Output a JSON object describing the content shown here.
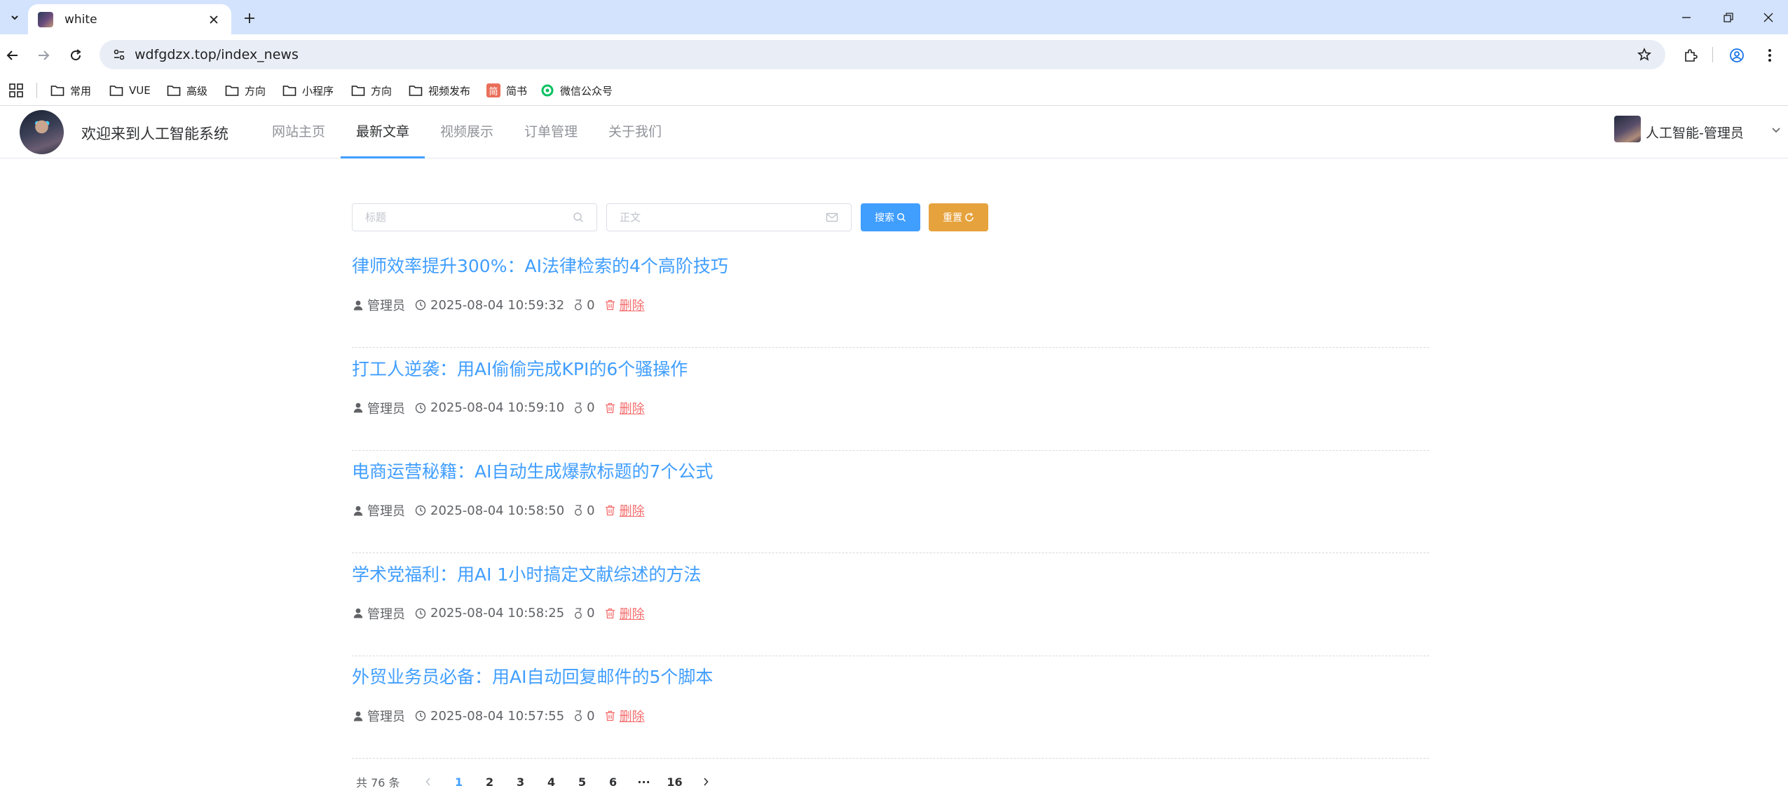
{
  "browser": {
    "tab_title": "white",
    "url": "wdfgdzx.top/index_news",
    "bookmarks": [
      "常用",
      "VUE",
      "高级",
      "方向",
      "小程序",
      "方向",
      "视频发布",
      "简书",
      "微信公众号"
    ],
    "jianshu_glyph": "简"
  },
  "header": {
    "site_title": "欢迎来到人工智能系统",
    "nav": [
      "网站主页",
      "最新文章",
      "视频展示",
      "订单管理",
      "关于我们"
    ],
    "active_nav": 1,
    "user_name": "人工智能-管理员"
  },
  "search": {
    "title_placeholder": "标题",
    "content_placeholder": "正文",
    "search_label": "搜索",
    "reset_label": "重置"
  },
  "articles": [
    {
      "title": "律师效率提升300%：AI法律检索的4个高阶技巧",
      "author": "管理员",
      "time": "2025-08-04 10:59:32",
      "count": "0",
      "delete_label": "删除"
    },
    {
      "title": "打工人逆袭：用AI偷偷完成KPI的6个骚操作",
      "author": "管理员",
      "time": "2025-08-04 10:59:10",
      "count": "0",
      "delete_label": "删除"
    },
    {
      "title": "电商运营秘籍：AI自动生成爆款标题的7个公式",
      "author": "管理员",
      "time": "2025-08-04 10:58:50",
      "count": "0",
      "delete_label": "删除"
    },
    {
      "title": "学术党福利：用AI 1小时搞定文献综述的方法",
      "author": "管理员",
      "time": "2025-08-04 10:58:25",
      "count": "0",
      "delete_label": "删除"
    },
    {
      "title": "外贸业务员必备：用AI自动回复邮件的5个脚本",
      "author": "管理员",
      "time": "2025-08-04 10:57:55",
      "count": "0",
      "delete_label": "删除"
    }
  ],
  "pagination": {
    "total_label": "共 76 条",
    "pages": [
      "1",
      "2",
      "3",
      "4",
      "5",
      "6",
      "···",
      "16"
    ],
    "current": "1"
  },
  "colors": {
    "primary": "#409eff",
    "warning": "#e6a23c",
    "danger": "#f56c6c"
  }
}
